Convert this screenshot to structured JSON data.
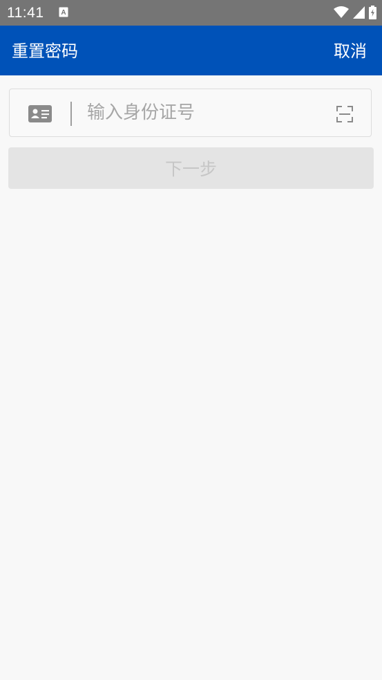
{
  "status_bar": {
    "time": "11:41",
    "icons": [
      "notification-a-icon",
      "wifi-icon",
      "signal-icon",
      "battery-charging-icon"
    ]
  },
  "header": {
    "title": "重置密码",
    "cancel_label": "取消",
    "background_color": "#0052b8"
  },
  "form": {
    "id_field": {
      "icon": "id-card-icon",
      "placeholder": "输入身份证号",
      "value": "",
      "scan_icon": "scan-icon"
    },
    "next_button": {
      "label": "下一步",
      "enabled": false
    }
  }
}
